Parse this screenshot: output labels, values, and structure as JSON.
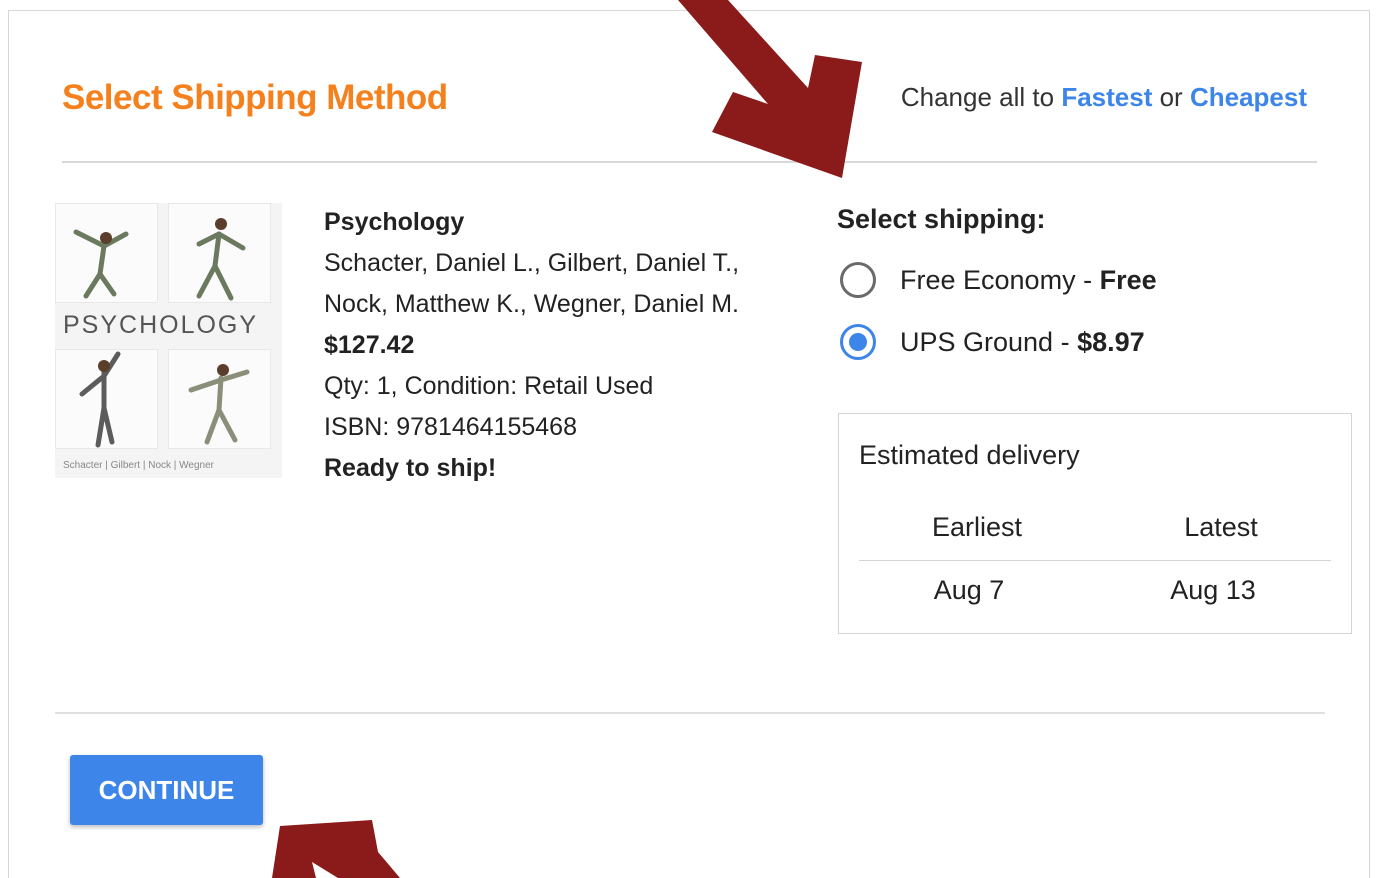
{
  "header": {
    "title": "Select Shipping Method",
    "change_all_prefix": "Change all to",
    "fastest_label": "Fastest",
    "or_text": "or",
    "cheapest_label": "Cheapest"
  },
  "book": {
    "cover_word": "PSYCHOLOGY",
    "cover_authors": "Schacter | Gilbert | Nock | Wegner",
    "title": "Psychology",
    "authors": "Schacter, Daniel L., Gilbert, Daniel T., Nock, Matthew K., Wegner, Daniel M.",
    "price": "$127.42",
    "qty_condition": "Qty: 1, Condition: Retail Used",
    "isbn": "ISBN: 9781464155468",
    "status": "Ready to ship!"
  },
  "shipping": {
    "heading": "Select shipping:",
    "options": [
      {
        "name": "Free Economy",
        "separator": " - ",
        "price": "Free",
        "selected": false
      },
      {
        "name": "UPS Ground",
        "separator": " - ",
        "price": "$8.97",
        "selected": true
      }
    ]
  },
  "delivery": {
    "title": "Estimated delivery",
    "earliest_label": "Earliest",
    "latest_label": "Latest",
    "earliest_value": "Aug 7",
    "latest_value": "Aug 13"
  },
  "actions": {
    "continue_label": "CONTINUE"
  },
  "colors": {
    "title_orange": "#f5801e",
    "link_blue": "#3d85e8",
    "arrow_red": "#8b1a1a"
  }
}
